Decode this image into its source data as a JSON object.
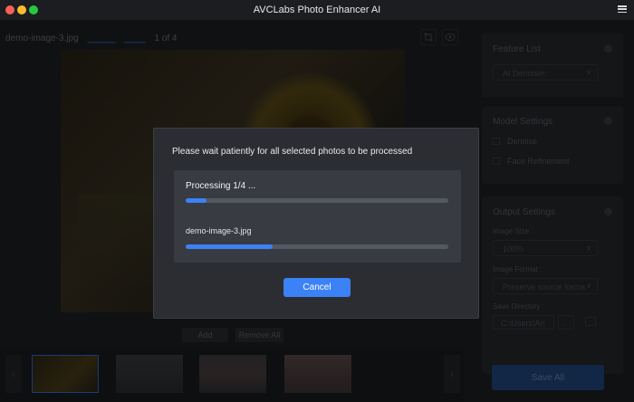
{
  "window": {
    "title": "AVCLabs Photo Enhancer AI"
  },
  "toolbar": {
    "file_name": "demo-image-3.jpg",
    "page_indicator": "1 of 4"
  },
  "preview": {
    "add_label": "Add",
    "remove_all_label": "Remove All"
  },
  "right_panel": {
    "feature_list": {
      "title": "Feature List",
      "selected": "AI Denoiser"
    },
    "model_settings": {
      "title": "Model Settings",
      "options": [
        {
          "label": "Denoise",
          "checked": false
        },
        {
          "label": "Face Refinement",
          "checked": false
        }
      ]
    },
    "output_settings": {
      "title": "Output Settings",
      "image_size_label": "Image Size :",
      "image_size_value": "100%",
      "image_format_label": "Image Format :",
      "image_format_value": "Preserve source forma",
      "save_directory_label": "Save Directory :",
      "save_directory_value": "C:\\Users\\Ari",
      "browse_label": "..."
    },
    "save_all_label": "Save All"
  },
  "dialog": {
    "message": "Please wait patiently for all selected photos to be processed",
    "processing_label": "Processing 1/4 ...",
    "overall_progress": 0.08,
    "file_name": "demo-image-3.jpg",
    "file_progress": 0.33,
    "cancel_label": "Cancel"
  },
  "colors": {
    "accent": "#3b82f6",
    "dialog_bg": "#2b2d33",
    "progress_box_bg": "#383b42"
  }
}
